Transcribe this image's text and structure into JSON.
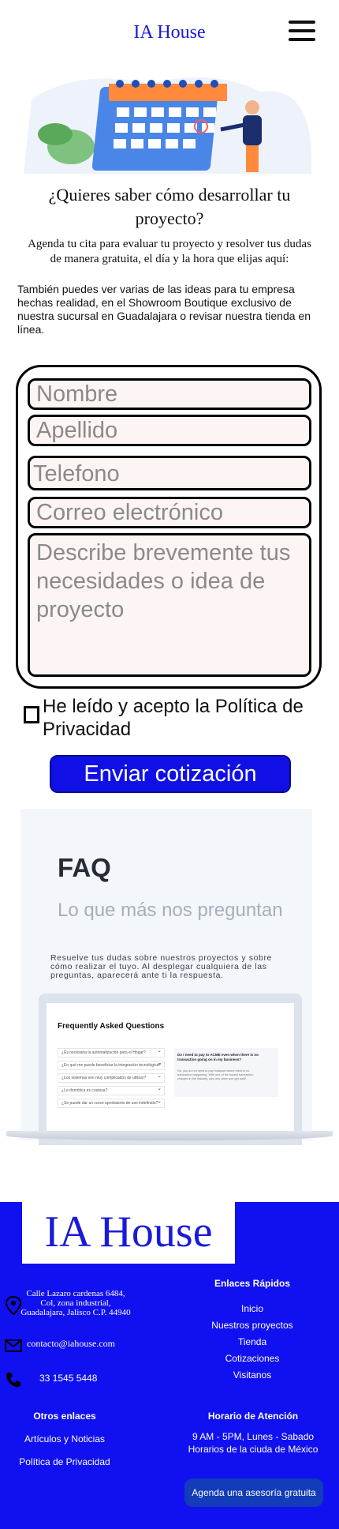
{
  "header": {
    "brand": "IA House"
  },
  "intro": {
    "title": "¿Quieres saber cómo desarrollar tu proyecto?",
    "subtitle": "Agenda tu cita para evaluar tu proyecto y resolver tus dudas de manera gratuita, el día y la hora que elijas aquí:",
    "body": "También puedes ver varias de las ideas para tu empresa hechas realidad, en el Showroom Boutique exclusivo de nuestra sucursal en Guadalajara o revisar nuestra tienda en línea."
  },
  "form": {
    "nombre_placeholder": "Nombre",
    "apellido_placeholder": "Apellido",
    "telefono_placeholder": "Telefono",
    "correo_placeholder": "Correo electrónico",
    "descripcion_placeholder": "Describe brevemente tus necesidades o idea de proyecto",
    "consent_label": "He leído y acepto la Política de Privacidad",
    "submit_label": "Enviar cotización"
  },
  "faq": {
    "title": "FAQ",
    "subtitle": "Lo que más nos preguntan",
    "body": "Resuelve tus dudas sobre nuestros proyectos y sobre cómo realizar el tuyo. Al desplegar cualquiera de las preguntas, aparecerá ante ti la respuesta.",
    "screen": {
      "title": "Frequently Asked Questions",
      "questions": [
        "¿Es necesaria la automatización para el Hogar?",
        "¿En qué me puede beneficiar la integración tecnológica?",
        "¿Los sistemas son muy complicados de utilizar?",
        "¿La domótica es costosa?",
        "¿Se puede dar un curso aprobatorio de uso indefinido?"
      ],
      "panel_question": "Do I need to pay to ACME even when there is no transaction going on in my business?",
      "panel_answer": "No, you do not need to pay Instacart where there is no transaction happening. With one of the lowest transaction charges in the industry, pay only when you get paid!"
    }
  },
  "footer": {
    "logo": "IA House",
    "address": "Calle Lazaro cardenas 6484, Col, zona industrial, Guadalajara, Jalisco C.P. 44940",
    "email": "contacto@iahouse.com",
    "phone": "33 1545 5448",
    "quick_links_title": "Enlaces Rápidos",
    "quick_links": [
      "Inicio",
      "Nuestros proyectos",
      "Tienda",
      "Cotizaciones",
      "Visitanos"
    ],
    "other_links_title": "Otros enlaces",
    "other_links": [
      "Artículos y Noticias",
      "Política de Privacidad"
    ],
    "hours_title": "Horario de Atención",
    "hours_line1": "9 AM - 5PM, Lunes - Sabado",
    "hours_line2": "Horarios de la ciuda de México",
    "cta_label": "Agenda una asesoría gratuita"
  },
  "colors": {
    "brand": "#1a1ad8",
    "footer_bg": "#1010f0",
    "button": "#1010e6"
  },
  "icons": [
    "menu-icon",
    "location-icon",
    "mail-icon",
    "phone-icon"
  ]
}
